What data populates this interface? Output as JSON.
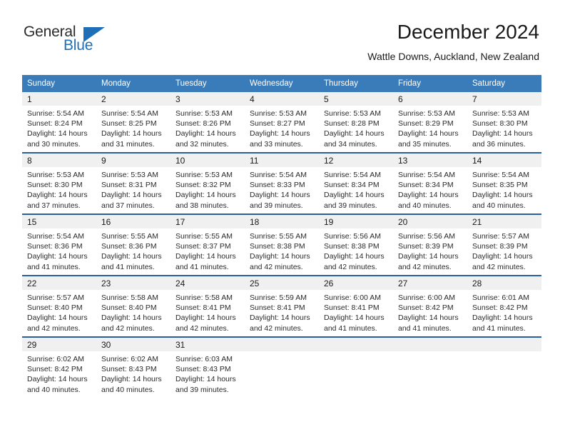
{
  "logo": {
    "word1": "General",
    "word2": "Blue",
    "triangle_color": "#1f6fb8",
    "text_color": "#2b2b2b"
  },
  "header": {
    "title": "December 2024",
    "subtitle": "Wattle Downs, Auckland, New Zealand"
  },
  "theme": {
    "header_blue": "#3a7cb9",
    "row_border_blue": "#2a6099",
    "day_band_gray": "#f0f0f0"
  },
  "weekdays": [
    "Sunday",
    "Monday",
    "Tuesday",
    "Wednesday",
    "Thursday",
    "Friday",
    "Saturday"
  ],
  "labels": {
    "sunrise": "Sunrise:",
    "sunset": "Sunset:",
    "daylight": "Daylight:"
  },
  "weeks": [
    [
      {
        "day": "1",
        "sunrise": "Sunrise: 5:54 AM",
        "sunset": "Sunset: 8:24 PM",
        "daylight1": "Daylight: 14 hours",
        "daylight2": "and 30 minutes."
      },
      {
        "day": "2",
        "sunrise": "Sunrise: 5:54 AM",
        "sunset": "Sunset: 8:25 PM",
        "daylight1": "Daylight: 14 hours",
        "daylight2": "and 31 minutes."
      },
      {
        "day": "3",
        "sunrise": "Sunrise: 5:53 AM",
        "sunset": "Sunset: 8:26 PM",
        "daylight1": "Daylight: 14 hours",
        "daylight2": "and 32 minutes."
      },
      {
        "day": "4",
        "sunrise": "Sunrise: 5:53 AM",
        "sunset": "Sunset: 8:27 PM",
        "daylight1": "Daylight: 14 hours",
        "daylight2": "and 33 minutes."
      },
      {
        "day": "5",
        "sunrise": "Sunrise: 5:53 AM",
        "sunset": "Sunset: 8:28 PM",
        "daylight1": "Daylight: 14 hours",
        "daylight2": "and 34 minutes."
      },
      {
        "day": "6",
        "sunrise": "Sunrise: 5:53 AM",
        "sunset": "Sunset: 8:29 PM",
        "daylight1": "Daylight: 14 hours",
        "daylight2": "and 35 minutes."
      },
      {
        "day": "7",
        "sunrise": "Sunrise: 5:53 AM",
        "sunset": "Sunset: 8:30 PM",
        "daylight1": "Daylight: 14 hours",
        "daylight2": "and 36 minutes."
      }
    ],
    [
      {
        "day": "8",
        "sunrise": "Sunrise: 5:53 AM",
        "sunset": "Sunset: 8:30 PM",
        "daylight1": "Daylight: 14 hours",
        "daylight2": "and 37 minutes."
      },
      {
        "day": "9",
        "sunrise": "Sunrise: 5:53 AM",
        "sunset": "Sunset: 8:31 PM",
        "daylight1": "Daylight: 14 hours",
        "daylight2": "and 37 minutes."
      },
      {
        "day": "10",
        "sunrise": "Sunrise: 5:53 AM",
        "sunset": "Sunset: 8:32 PM",
        "daylight1": "Daylight: 14 hours",
        "daylight2": "and 38 minutes."
      },
      {
        "day": "11",
        "sunrise": "Sunrise: 5:54 AM",
        "sunset": "Sunset: 8:33 PM",
        "daylight1": "Daylight: 14 hours",
        "daylight2": "and 39 minutes."
      },
      {
        "day": "12",
        "sunrise": "Sunrise: 5:54 AM",
        "sunset": "Sunset: 8:34 PM",
        "daylight1": "Daylight: 14 hours",
        "daylight2": "and 39 minutes."
      },
      {
        "day": "13",
        "sunrise": "Sunrise: 5:54 AM",
        "sunset": "Sunset: 8:34 PM",
        "daylight1": "Daylight: 14 hours",
        "daylight2": "and 40 minutes."
      },
      {
        "day": "14",
        "sunrise": "Sunrise: 5:54 AM",
        "sunset": "Sunset: 8:35 PM",
        "daylight1": "Daylight: 14 hours",
        "daylight2": "and 40 minutes."
      }
    ],
    [
      {
        "day": "15",
        "sunrise": "Sunrise: 5:54 AM",
        "sunset": "Sunset: 8:36 PM",
        "daylight1": "Daylight: 14 hours",
        "daylight2": "and 41 minutes."
      },
      {
        "day": "16",
        "sunrise": "Sunrise: 5:55 AM",
        "sunset": "Sunset: 8:36 PM",
        "daylight1": "Daylight: 14 hours",
        "daylight2": "and 41 minutes."
      },
      {
        "day": "17",
        "sunrise": "Sunrise: 5:55 AM",
        "sunset": "Sunset: 8:37 PM",
        "daylight1": "Daylight: 14 hours",
        "daylight2": "and 41 minutes."
      },
      {
        "day": "18",
        "sunrise": "Sunrise: 5:55 AM",
        "sunset": "Sunset: 8:38 PM",
        "daylight1": "Daylight: 14 hours",
        "daylight2": "and 42 minutes."
      },
      {
        "day": "19",
        "sunrise": "Sunrise: 5:56 AM",
        "sunset": "Sunset: 8:38 PM",
        "daylight1": "Daylight: 14 hours",
        "daylight2": "and 42 minutes."
      },
      {
        "day": "20",
        "sunrise": "Sunrise: 5:56 AM",
        "sunset": "Sunset: 8:39 PM",
        "daylight1": "Daylight: 14 hours",
        "daylight2": "and 42 minutes."
      },
      {
        "day": "21",
        "sunrise": "Sunrise: 5:57 AM",
        "sunset": "Sunset: 8:39 PM",
        "daylight1": "Daylight: 14 hours",
        "daylight2": "and 42 minutes."
      }
    ],
    [
      {
        "day": "22",
        "sunrise": "Sunrise: 5:57 AM",
        "sunset": "Sunset: 8:40 PM",
        "daylight1": "Daylight: 14 hours",
        "daylight2": "and 42 minutes."
      },
      {
        "day": "23",
        "sunrise": "Sunrise: 5:58 AM",
        "sunset": "Sunset: 8:40 PM",
        "daylight1": "Daylight: 14 hours",
        "daylight2": "and 42 minutes."
      },
      {
        "day": "24",
        "sunrise": "Sunrise: 5:58 AM",
        "sunset": "Sunset: 8:41 PM",
        "daylight1": "Daylight: 14 hours",
        "daylight2": "and 42 minutes."
      },
      {
        "day": "25",
        "sunrise": "Sunrise: 5:59 AM",
        "sunset": "Sunset: 8:41 PM",
        "daylight1": "Daylight: 14 hours",
        "daylight2": "and 42 minutes."
      },
      {
        "day": "26",
        "sunrise": "Sunrise: 6:00 AM",
        "sunset": "Sunset: 8:41 PM",
        "daylight1": "Daylight: 14 hours",
        "daylight2": "and 41 minutes."
      },
      {
        "day": "27",
        "sunrise": "Sunrise: 6:00 AM",
        "sunset": "Sunset: 8:42 PM",
        "daylight1": "Daylight: 14 hours",
        "daylight2": "and 41 minutes."
      },
      {
        "day": "28",
        "sunrise": "Sunrise: 6:01 AM",
        "sunset": "Sunset: 8:42 PM",
        "daylight1": "Daylight: 14 hours",
        "daylight2": "and 41 minutes."
      }
    ],
    [
      {
        "day": "29",
        "sunrise": "Sunrise: 6:02 AM",
        "sunset": "Sunset: 8:42 PM",
        "daylight1": "Daylight: 14 hours",
        "daylight2": "and 40 minutes."
      },
      {
        "day": "30",
        "sunrise": "Sunrise: 6:02 AM",
        "sunset": "Sunset: 8:43 PM",
        "daylight1": "Daylight: 14 hours",
        "daylight2": "and 40 minutes."
      },
      {
        "day": "31",
        "sunrise": "Sunrise: 6:03 AM",
        "sunset": "Sunset: 8:43 PM",
        "daylight1": "Daylight: 14 hours",
        "daylight2": "and 39 minutes."
      },
      {
        "day": "",
        "sunrise": "",
        "sunset": "",
        "daylight1": "",
        "daylight2": ""
      },
      {
        "day": "",
        "sunrise": "",
        "sunset": "",
        "daylight1": "",
        "daylight2": ""
      },
      {
        "day": "",
        "sunrise": "",
        "sunset": "",
        "daylight1": "",
        "daylight2": ""
      },
      {
        "day": "",
        "sunrise": "",
        "sunset": "",
        "daylight1": "",
        "daylight2": ""
      }
    ]
  ]
}
